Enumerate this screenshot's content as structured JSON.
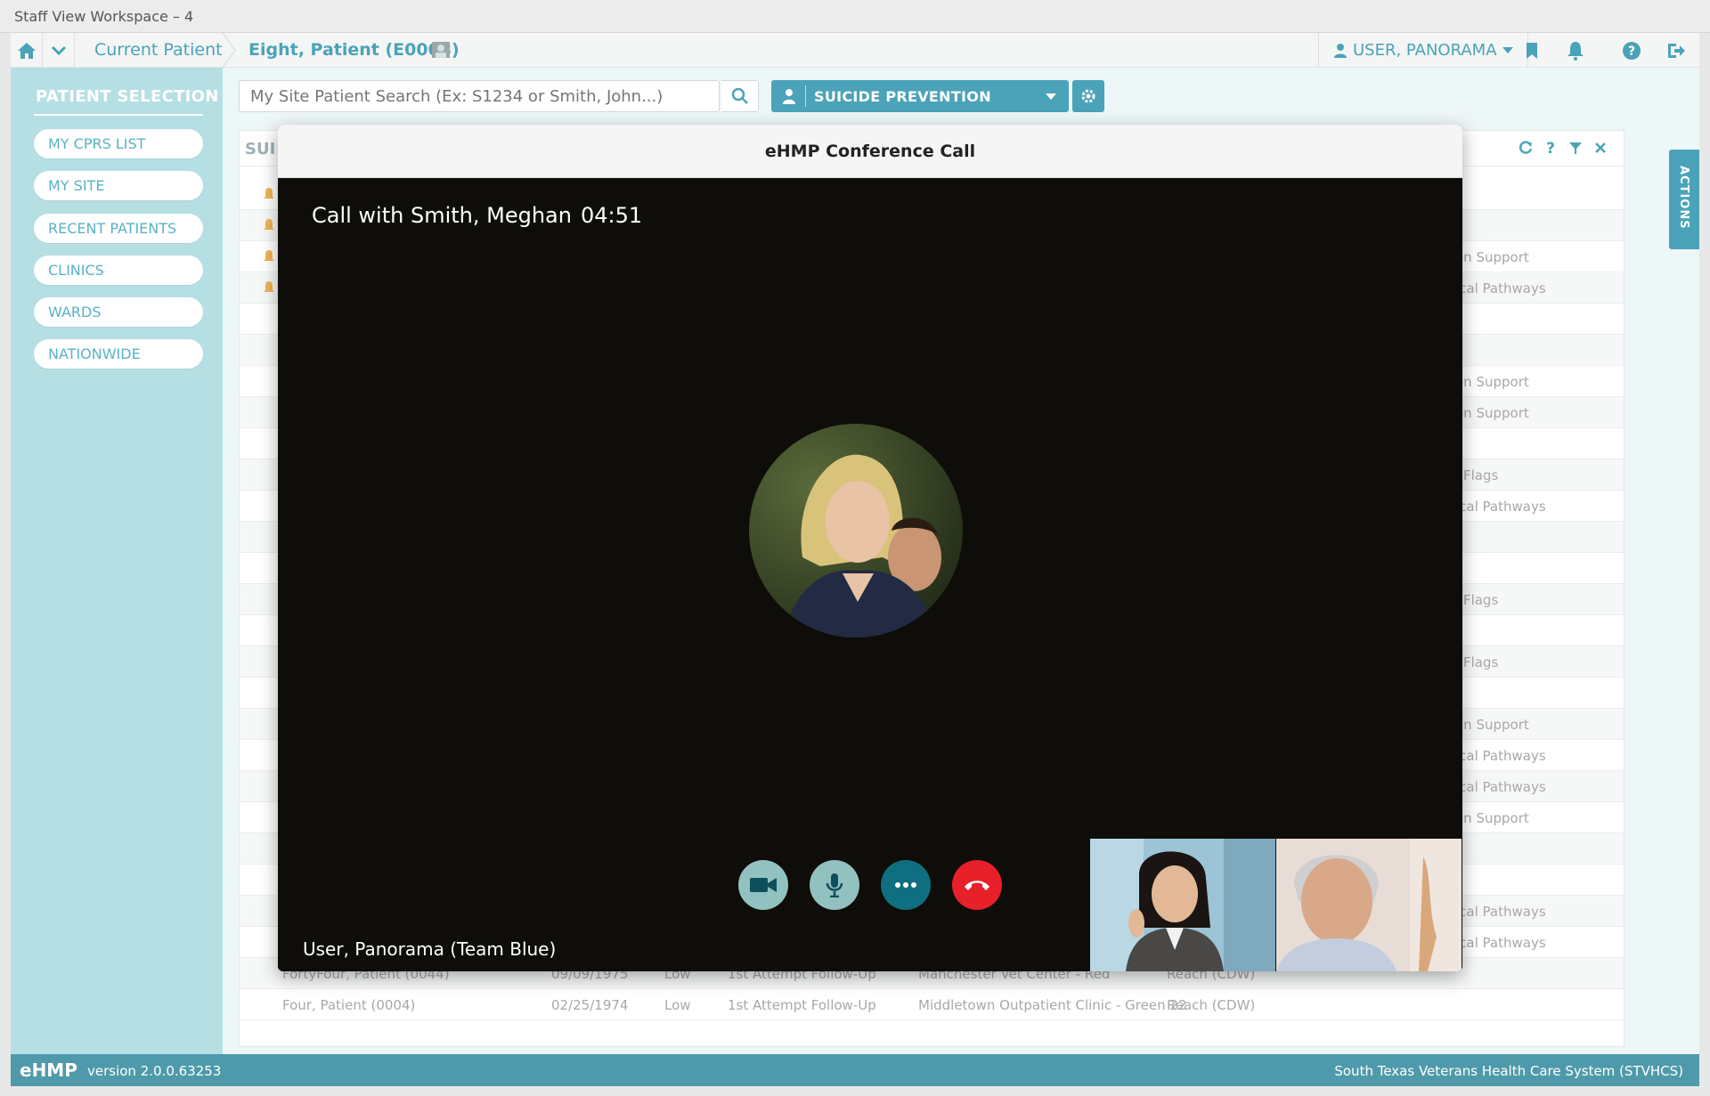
{
  "window": {
    "title": "Staff View Workspace – 4"
  },
  "nav": {
    "breadcrumb_current": "Current Patient",
    "patient": "Eight, Patient (E0008)",
    "user": "USER, PANORAMA"
  },
  "sidebar": {
    "title": "PATIENT SELECTION",
    "items": [
      {
        "label": "MY CPRS LIST"
      },
      {
        "label": "MY SITE"
      },
      {
        "label": "RECENT PATIENTS"
      },
      {
        "label": "CLINICS"
      },
      {
        "label": "WARDS"
      },
      {
        "label": "NATIONWIDE"
      }
    ]
  },
  "search": {
    "placeholder": "My Site Patient Search (Ex: S1234 or Smith, John...)"
  },
  "workspace": {
    "label": "SUICIDE PREVENTION"
  },
  "applet": {
    "title": "SUI",
    "right_fragments": [
      "on Support",
      "ical Pathways",
      "on Support",
      "on Support",
      "l Flags",
      "ical Pathways",
      "l Flags",
      "l Flags",
      "on Support",
      "ical Pathways",
      "ical Pathways",
      "on Support",
      "ical Pathways",
      "ical Pathways"
    ],
    "rows": [
      {
        "name": "FortyFour, Patient (0044)",
        "dob": "09/09/1975",
        "risk": "Low",
        "type": "1st Attempt Follow-Up",
        "location": "Manchester Vet Center - Red",
        "source": "Reach (CDW)"
      },
      {
        "name": "Four, Patient (0004)",
        "dob": "02/25/1974",
        "risk": "Low",
        "type": "1st Attempt Follow-Up",
        "location": "Middletown Outpatient Clinic - Green 22",
        "source": "Reach (CDW)"
      }
    ]
  },
  "actions_tab": "ACTIONS",
  "call": {
    "modal_title": "eHMP Conference Call",
    "with": "Call with Smith, Meghan",
    "timer": "04:51",
    "self": "User, Panorama (Team Blue)"
  },
  "footer": {
    "brand": "eHMP",
    "version": "version 2.0.0.63253",
    "org": "South Texas Veterans Health Care System (STVHCS)"
  },
  "colors": {
    "accent": "#4aa3b8",
    "sidebar": "#b5dfe3",
    "hangup": "#e8202a",
    "video_bg": "#0e0d09"
  }
}
